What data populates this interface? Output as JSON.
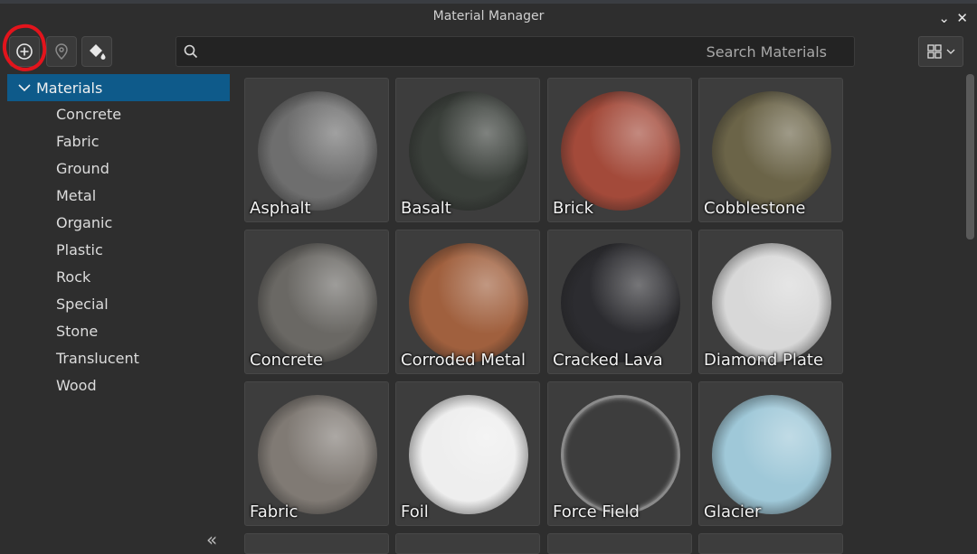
{
  "window": {
    "title": "Material Manager"
  },
  "toolbar": {
    "icons": [
      "add-circle-icon",
      "pin-icon",
      "paint-bucket-icon"
    ]
  },
  "search": {
    "placeholder": "Search Materials",
    "value": ""
  },
  "sidebar": {
    "root": "Materials",
    "items": [
      "Concrete",
      "Fabric",
      "Ground",
      "Metal",
      "Organic",
      "Plastic",
      "Rock",
      "Special",
      "Stone",
      "Translucent",
      "Wood"
    ],
    "collapse_glyph": "«"
  },
  "materials": [
    {
      "name": "Asphalt",
      "color": "#6e6e6e"
    },
    {
      "name": "Basalt",
      "color": "#3a3f3a"
    },
    {
      "name": "Brick",
      "color": "#a34a3a"
    },
    {
      "name": "Cobblestone",
      "color": "#6b6448"
    },
    {
      "name": "Concrete",
      "color": "#6a6864"
    },
    {
      "name": "Corroded Metal",
      "color": "#a0603e"
    },
    {
      "name": "Cracked Lava",
      "color": "#2c2c30"
    },
    {
      "name": "Diamond Plate",
      "color": "#d8d8d8"
    },
    {
      "name": "Fabric",
      "color": "#807a74"
    },
    {
      "name": "Foil",
      "color": "#eeeeee"
    },
    {
      "name": "Force Field",
      "color": "#3a3a3a"
    },
    {
      "name": "Glacier",
      "color": "#9fc8d8"
    }
  ],
  "colors": {
    "accent": "#0e5a8a",
    "highlight": "#e3141c"
  }
}
